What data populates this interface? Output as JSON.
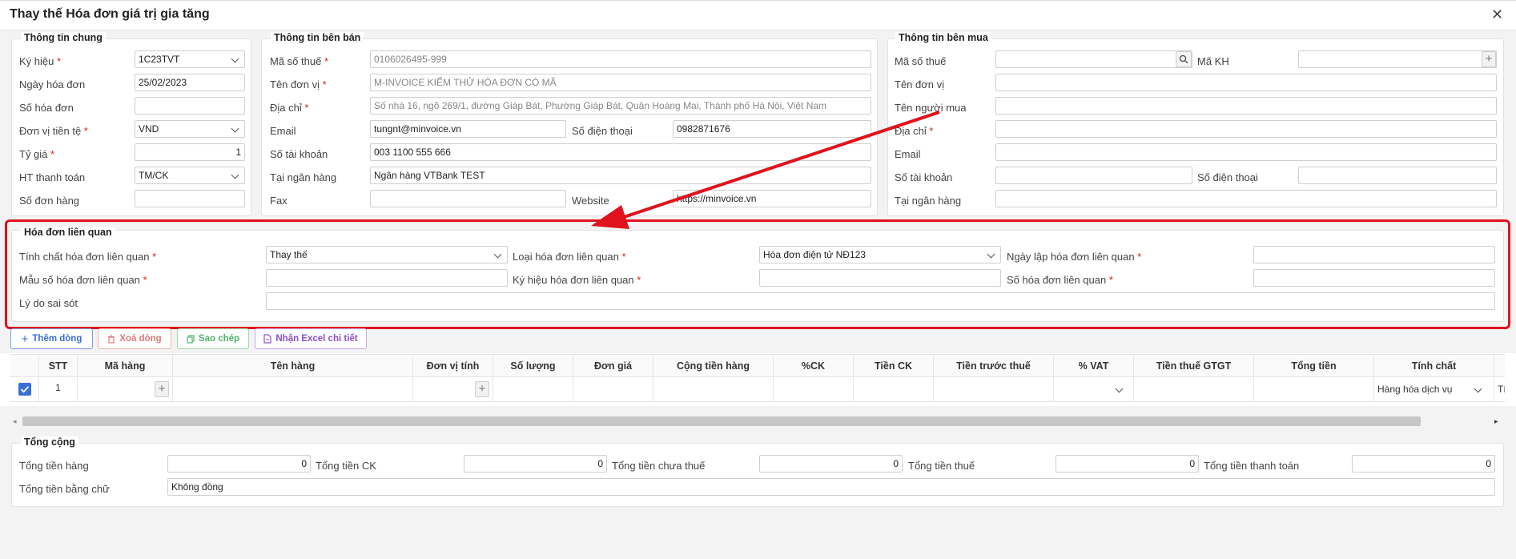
{
  "window": {
    "title": "Thay thế Hóa đơn giá trị gia tăng",
    "close_icon": "close-icon"
  },
  "general": {
    "legend": "Thông tin chung",
    "symbol": {
      "label": "Ký hiệu",
      "value": "1C23TVT"
    },
    "invoice_date": {
      "label": "Ngày hóa đơn",
      "value": "25/02/2023"
    },
    "invoice_no": {
      "label": "Số hóa đơn",
      "value": ""
    },
    "currency": {
      "label": "Đơn vị tiền tệ",
      "value": "VND"
    },
    "rate": {
      "label": "Tỷ giá",
      "value": "1"
    },
    "payment": {
      "label": "HT thanh toán",
      "value": "TM/CK"
    },
    "order_no": {
      "label": "Số đơn hàng",
      "value": ""
    }
  },
  "seller": {
    "legend": "Thông tin bên bán",
    "tax_code": {
      "label": "Mã số thuế",
      "value": "0106026495-999"
    },
    "name": {
      "label": "Tên đơn vị",
      "value": "M-INVOICE KIỂM THỬ HÓA ĐƠN CÓ MÃ"
    },
    "address": {
      "label": "Địa chỉ",
      "value": "Số nhà 16, ngõ 269/1, đường Giáp Bát, Phường Giáp Bát, Quận Hoàng Mai, Thành phố Hà Nội, Việt Nam"
    },
    "email": {
      "label": "Email",
      "value": "tungnt@minvoice.vn"
    },
    "phone": {
      "label": "Số điện thoại",
      "value": "0982871676"
    },
    "account": {
      "label": "Số tài khoản",
      "value": "003 1100 555 666"
    },
    "bank": {
      "label": "Tại ngân hàng",
      "value": "Ngân hàng VTBank TEST"
    },
    "fax": {
      "label": "Fax",
      "value": ""
    },
    "website": {
      "label": "Website",
      "value": "https://minvoice.vn"
    }
  },
  "buyer": {
    "legend": "Thông tin bên mua",
    "tax_code": {
      "label": "Mã số thuế",
      "value": ""
    },
    "customer_code": {
      "label": "Mã KH",
      "value": ""
    },
    "company": {
      "label": "Tên đơn vị",
      "value": ""
    },
    "buyer_name": {
      "label": "Tên người mua",
      "value": ""
    },
    "address": {
      "label": "Địa chỉ",
      "value": ""
    },
    "email": {
      "label": "Email",
      "value": ""
    },
    "account": {
      "label": "Số tài khoản",
      "value": ""
    },
    "phone": {
      "label": "Số điện thoại",
      "value": ""
    },
    "bank": {
      "label": "Tại ngân hàng",
      "value": ""
    }
  },
  "related": {
    "legend": "Hóa đơn liên quan",
    "nature": {
      "label": "Tính chất hóa đơn liên quan",
      "value": "Thay thế"
    },
    "type": {
      "label": "Loại hóa đơn liên quan",
      "value": "Hóa đơn điện tử NĐ123"
    },
    "date": {
      "label": "Ngày lập hóa đơn liên quan",
      "value": ""
    },
    "template": {
      "label": "Mẫu số hóa đơn liên quan",
      "value": ""
    },
    "symbol": {
      "label": "Ký hiệu hóa đơn liên quan",
      "value": ""
    },
    "number": {
      "label": "Số hóa đơn liên quan",
      "value": ""
    },
    "reason": {
      "label": "Lý do sai sót",
      "value": ""
    }
  },
  "toolbar": {
    "add": "Thêm dòng",
    "delete": "Xoá dòng",
    "copy": "Sao chép",
    "excel": "Nhận Excel chi tiết"
  },
  "table": {
    "headers": [
      "STT",
      "Mã hàng",
      "Tên hàng",
      "Đơn vị tính",
      "Số lượng",
      "Đơn giá",
      "Cộng tiền hàng",
      "%CK",
      "Tiền CK",
      "Tiền trước thuế",
      "% VAT",
      "Tiền thuế GTGT",
      "Tổng tiền",
      "Tính chất"
    ],
    "rows": [
      {
        "stt": "1",
        "nature": "Hàng hóa dịch vụ",
        "extra": "Tính"
      }
    ]
  },
  "totals": {
    "legend": "Tổng cộng",
    "goods": {
      "label": "Tổng tiền hàng",
      "value": "0"
    },
    "discount": {
      "label": "Tổng tiền CK",
      "value": "0"
    },
    "pretax": {
      "label": "Tổng tiền chưa thuế",
      "value": "0"
    },
    "tax": {
      "label": "Tổng tiền thuế",
      "value": "0"
    },
    "payment": {
      "label": "Tổng tiền thanh toán",
      "value": "0"
    },
    "words": {
      "label": "Tổng tiền bằng chữ",
      "value": "Không đồng"
    }
  },
  "colors": {
    "annotation_red": "#e0121d",
    "add_blue": "#3b6fd6",
    "delete_red": "#e57878",
    "copy_green": "#4cb56a",
    "excel_purple": "#8a4fc9"
  }
}
